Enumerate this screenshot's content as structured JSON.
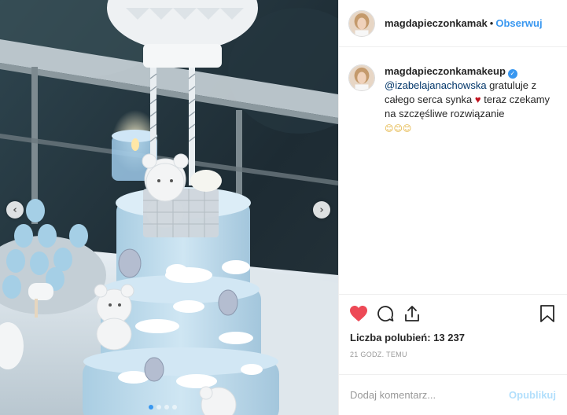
{
  "post": {
    "username": "magdapieczonkamak",
    "separator": "•",
    "follow_label": "Obserwuj"
  },
  "caption": {
    "username": "magdapieczonkamakeup",
    "verified": true,
    "mention": "@izabelajanachowska",
    "text_part1": " gratuluje z całego serca synka ",
    "heart": "♥",
    "text_part2": " teraz czekamy na szczęśliwe rozwiązanie",
    "emojis": "😊😊😊"
  },
  "actions": {
    "like_icon": "heart-icon",
    "comment_icon": "comment-icon",
    "share_icon": "share-icon",
    "save_icon": "bookmark-icon",
    "like_color": "#ed4956"
  },
  "likes": {
    "label": "Liczba polubień: ",
    "count": "13 237"
  },
  "timestamp": "21 GODZ. TEMU",
  "comment_box": {
    "placeholder": "Dodaj komentarz...",
    "post_label": "Opublikuj"
  },
  "carousel": {
    "slides": 4,
    "active": 0,
    "prev_icon": "chevron-left-icon",
    "next_icon": "chevron-right-icon",
    "prev_glyph": "‹",
    "next_glyph": "›"
  }
}
